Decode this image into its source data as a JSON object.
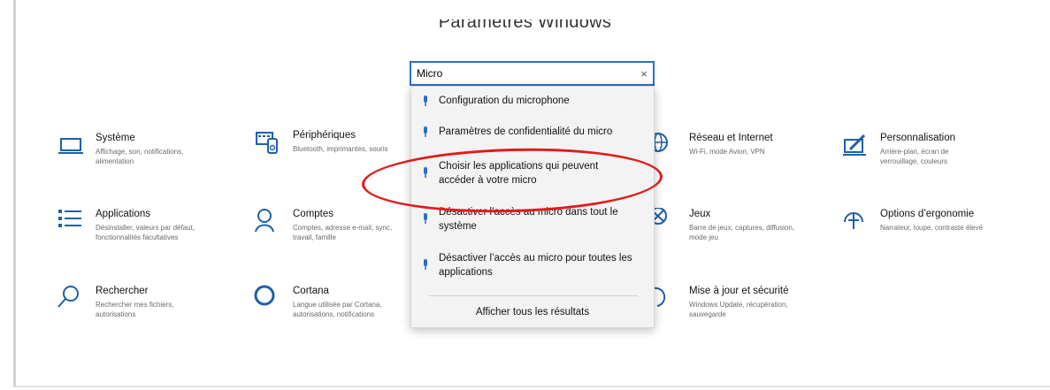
{
  "window": {
    "title": "Paramètres Windows"
  },
  "search": {
    "value": "Micro",
    "clear_symbol": "×"
  },
  "dropdown": {
    "items": [
      {
        "label": "Configuration du microphone"
      },
      {
        "label": "Paramètres de confidentialité du micro"
      },
      {
        "label": "Choisir les applications qui peuvent accéder à votre micro"
      },
      {
        "label": "Désactiver l’accès au micro dans tout le système"
      },
      {
        "label": "Désactiver l’accès au micro pour toutes les applications"
      }
    ],
    "show_all": "Afficher tous les résultats"
  },
  "tiles": [
    {
      "title": "Système",
      "desc": "Affichage, son, notifications, alimentation",
      "icon": "laptop-icon"
    },
    {
      "title": "Périphériques",
      "desc": "Bluetooth, imprimantes, souris",
      "icon": "devices-icon"
    },
    {
      "title": "Réseau et Internet",
      "desc": "Wi-Fi, mode Avion, VPN",
      "icon": "globe-icon"
    },
    {
      "title": "Personnalisation",
      "desc": "Arrière-plan, écran de verrouillage, couleurs",
      "icon": "personalization-icon"
    },
    {
      "title": "Applications",
      "desc": "Désinstaller, valeurs par défaut, fonctionnalités facultatives",
      "icon": "apps-list-icon"
    },
    {
      "title": "Comptes",
      "desc": "Comptes, adresse e-mail, sync, travail, famille",
      "icon": "person-icon"
    },
    {
      "title": "Jeux",
      "desc": "Barre de jeux, captures, diffusion, mode jeu",
      "icon": "xbox-icon"
    },
    {
      "title": "Options d’ergonomie",
      "desc": "Narrateur, loupe, contraste élevé",
      "icon": "ease-of-access-icon"
    },
    {
      "title": "Rechercher",
      "desc": "Rechercher mes fichiers, autorisations",
      "icon": "search-icon"
    },
    {
      "title": "Cortana",
      "desc": "Langue utilisée par Cortana, autorisations, notifications",
      "icon": "cortana-icon"
    },
    {
      "title": "Mise à jour et sécurité",
      "desc": "Windows Update, récupération, sauvegarde",
      "icon": "update-icon"
    }
  ],
  "colors": {
    "accent": "#2b6fbf",
    "icon": "#1f5fa8",
    "highlight": "#e31b1b"
  }
}
